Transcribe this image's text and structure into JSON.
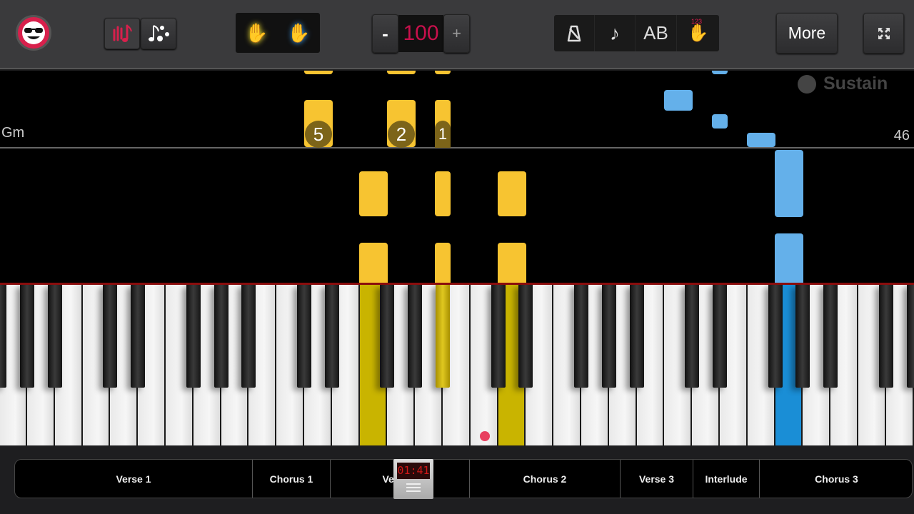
{
  "toolbar": {
    "logo_icon": "sunglasses-smiley-logo",
    "mode_buttons": [
      {
        "icon": "hand-note-icon",
        "active": true
      },
      {
        "icon": "notes-dots-icon",
        "active": false
      }
    ],
    "hands": [
      {
        "icon": "left-hand-icon",
        "color": "#f2e030"
      },
      {
        "icon": "right-hand-icon",
        "color": "#3a9ff0"
      }
    ],
    "tempo": {
      "minus": "-",
      "value": "100",
      "plus": "+",
      "value_color": "#c8104c"
    },
    "tools": [
      {
        "icon": "metronome-icon"
      },
      {
        "icon": "music-note-icon"
      },
      {
        "label": "AB",
        "icon": "ab-loop-icon"
      },
      {
        "icon": "fingering-hand-icon",
        "digits": "123"
      }
    ],
    "more_label": "More",
    "fullscreen_icon": "fullscreen-icon"
  },
  "roll": {
    "chord": "Gm",
    "measure": "46",
    "sustain_label": "Sustain",
    "fingering": [
      "5",
      "2",
      "1"
    ],
    "left_hand_color": "#f7c431",
    "right_hand_color": "#64b0ea"
  },
  "keyboard": {
    "left_hand_key_color": "#c9b400",
    "right_hand_key_color": "#1a8ed6",
    "marker_color": "#e84060"
  },
  "sections": [
    "Verse 1",
    "Chorus 1",
    "Verse 2",
    "Chorus 2",
    "Verse 3",
    "Interlude",
    "Chorus 3"
  ],
  "playhead": {
    "time": "01:41"
  }
}
